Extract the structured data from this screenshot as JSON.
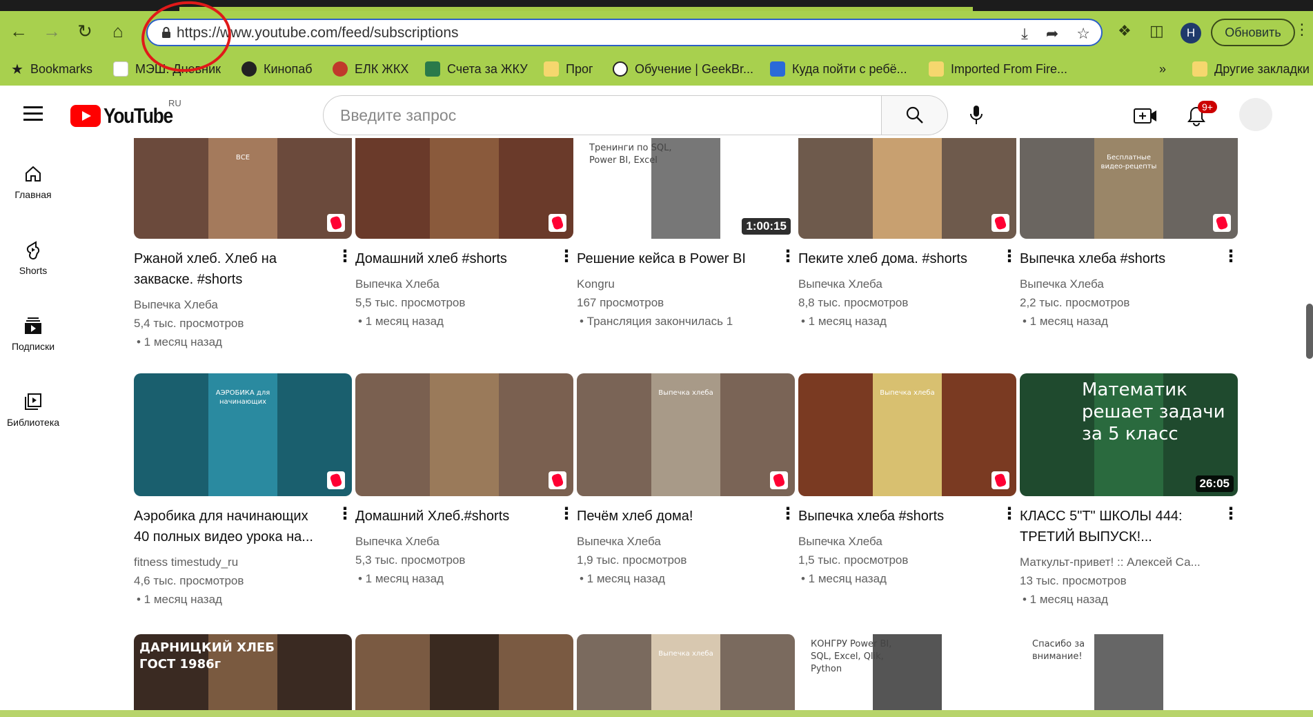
{
  "browser": {
    "url": "https://www.youtube.com/feed/subscriptions",
    "update_label": "Обновить",
    "profile_initial": "Н",
    "bookmarks": [
      {
        "label": "Bookmarks",
        "icon": "star-icon"
      },
      {
        "label": "МЭШ. Дневник",
        "icon": "diary-icon"
      },
      {
        "label": "Кинопаб",
        "icon": "kinopub-icon"
      },
      {
        "label": "ЕЛК ЖКХ",
        "icon": "mos-icon"
      },
      {
        "label": "Счета за ЖКУ",
        "icon": "house-icon"
      },
      {
        "label": "Прог",
        "icon": "folder-icon"
      },
      {
        "label": "Обучение | GeekBr...",
        "icon": "geekbrains-icon"
      },
      {
        "label": "Куда пойти с ребё...",
        "icon": "kuda-icon"
      },
      {
        "label": "Imported From Fire...",
        "icon": "folder-icon"
      },
      {
        "label": "»",
        "icon": "overflow-icon"
      },
      {
        "label": "Другие закладки",
        "icon": "folder-icon"
      }
    ]
  },
  "youtube": {
    "logo_text": "YouTube",
    "country_code": "RU",
    "search_placeholder": "Введите запрос",
    "notification_count": "9+",
    "sidebar": [
      {
        "label": "Главная",
        "icon": "home-icon"
      },
      {
        "label": "Shorts",
        "icon": "shorts-icon"
      },
      {
        "label": "Подписки",
        "icon": "subscriptions-icon"
      },
      {
        "label": "Библиотека",
        "icon": "library-icon"
      }
    ],
    "rows": [
      [
        {
          "title": "Ржаной хлеб. Хлеб на закваске. #shorts",
          "channel": "Выпечка Хлеба",
          "views": "5,4 тыс. просмотров",
          "age": "• 1 месяц назад",
          "badge": "shorts",
          "thumb_text": "ВСЕ",
          "bg": "#6b4a3c",
          "inner": "#a47a5c"
        },
        {
          "title": "Домашний хлеб #shorts",
          "channel": "Выпечка Хлеба",
          "views": "5,5 тыс. просмотров",
          "age": "• 1 месяц назад",
          "badge": "shorts",
          "thumb_text": "",
          "bg": "#6a3a2a",
          "inner": "#8a5a3c"
        },
        {
          "title": "Решение кейса в Power BI",
          "channel": "Kongru",
          "views": "167 просмотров",
          "age": "• Трансляция закончилась 1",
          "badge": "duration",
          "duration": "1:00:15",
          "thumb_text": "Тренинги по SQL, Power BI, Excel",
          "bg": "#ffffff",
          "inner": "#777777"
        },
        {
          "title": "Пеките хлеб дома. #shorts",
          "channel": "Выпечка Хлеба",
          "views": "8,8 тыс. просмотров",
          "age": "• 1 месяц назад",
          "badge": "shorts",
          "thumb_text": "",
          "bg": "#6e5a4c",
          "inner": "#c8a070"
        },
        {
          "title": "Выпечка хлеба #shorts",
          "channel": "Выпечка Хлеба",
          "views": "2,2 тыс. просмотров",
          "age": "• 1 месяц назад",
          "badge": "shorts",
          "thumb_text": "Бесплатные видео-рецепты",
          "bg": "#6a6560",
          "inner": "#9a8668"
        }
      ],
      [
        {
          "title": "Аэробика для начинающих 40 полных видео урока на...",
          "channel": "fitness timestudy_ru",
          "views": "4,6 тыс. просмотров",
          "age": "• 1 месяц назад",
          "badge": "shorts",
          "thumb_text": "АЭРОБИКА для начинающих",
          "bg": "#1a5f6e",
          "inner": "#2a8aa0"
        },
        {
          "title": "Домашний Хлеб.#shorts",
          "channel": "Выпечка Хлеба",
          "views": "5,3 тыс. просмотров",
          "age": "• 1 месяц назад",
          "badge": "shorts",
          "thumb_text": "",
          "bg": "#7a6050",
          "inner": "#9a7a5a"
        },
        {
          "title": "Печём хлеб дома!",
          "channel": "Выпечка Хлеба",
          "views": "1,9 тыс. просмотров",
          "age": "• 1 месяц назад",
          "badge": "shorts",
          "thumb_text": "Выпечка хлеба",
          "bg": "#7a6456",
          "inner": "#a89a88"
        },
        {
          "title": "Выпечка хлеба #shorts",
          "channel": "Выпечка Хлеба",
          "views": "1,5 тыс. просмотров",
          "age": "• 1 месяц назад",
          "badge": "shorts",
          "thumb_text": "Выпечка хлеба",
          "bg": "#7a3a22",
          "inner": "#d8c070"
        },
        {
          "title": "КЛАСС 5\"Т\" ШКОЛЫ 444: ТРЕТИЙ ВЫПУСК!...",
          "channel": "Маткульт-привет! :: Алексей Са...",
          "views": "13 тыс. просмотров",
          "age": "• 1 месяц назад",
          "badge": "duration",
          "duration": "26:05",
          "thumb_text": "Математик решает задачи за 5 класс",
          "bg": "#1f4a2e",
          "inner": "#2a6a3e"
        }
      ],
      [
        {
          "title": "",
          "channel": "",
          "views": "",
          "age": "",
          "badge": "none",
          "thumb_text": "ДАРНИЦКИЙ ХЛЕБ ГОСТ 1986г",
          "bg": "#3a2a22",
          "inner": "#7a5a40"
        },
        {
          "title": "",
          "channel": "",
          "views": "",
          "age": "",
          "badge": "none",
          "thumb_text": "",
          "bg": "#7a5a42",
          "inner": "#3a2a20"
        },
        {
          "title": "",
          "channel": "",
          "views": "",
          "age": "",
          "badge": "none",
          "thumb_text": "Выпечка хлеба",
          "bg": "#7a6a5e",
          "inner": "#d8c8b0"
        },
        {
          "title": "",
          "channel": "",
          "views": "",
          "age": "",
          "badge": "none",
          "thumb_text": "КОНГРУ Power BI, SQL, Excel, Qlik, Python",
          "bg": "#ffffff",
          "inner": "#555555"
        },
        {
          "title": "",
          "channel": "",
          "views": "",
          "age": "",
          "badge": "none",
          "thumb_text": "Спасибо за внимание!",
          "bg": "#ffffff",
          "inner": "#666666"
        }
      ]
    ]
  }
}
